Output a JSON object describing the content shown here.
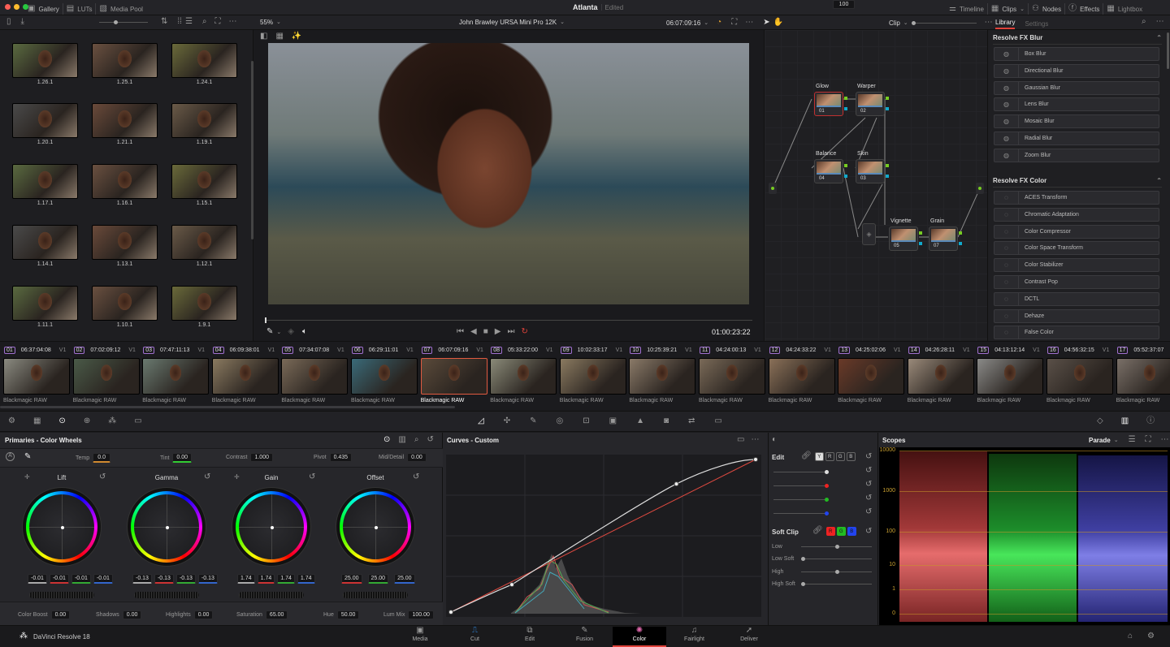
{
  "topbar": {
    "gallery": "Gallery",
    "luts": "LUTs",
    "media_pool": "Media Pool",
    "project": "Atlanta",
    "status": "Edited",
    "timeline": "Timeline",
    "clips": "Clips",
    "nodes": "Nodes",
    "effects": "Effects",
    "lightbox": "Lightbox"
  },
  "viewer": {
    "zoom": "55%",
    "clip_name": "John Brawley URSA Mini Pro 12K",
    "timecode": "06:07:09:16",
    "playhead": "01:00:23:22"
  },
  "nodes_bar": {
    "mode": "Clip"
  },
  "gallery": {
    "stills": [
      "1.26.1",
      "1.25.1",
      "1.24.1",
      "1.20.1",
      "1.21.1",
      "1.19.1",
      "1.17.1",
      "1.16.1",
      "1.15.1",
      "1.14.1",
      "1.13.1",
      "1.12.1",
      "1.11.1",
      "1.10.1",
      "1.9.1"
    ]
  },
  "node_graph": [
    {
      "name": "Glow",
      "num": "01"
    },
    {
      "name": "Warper",
      "num": "02"
    },
    {
      "name": "Balance",
      "num": "04"
    },
    {
      "name": "Skin",
      "num": "03"
    },
    {
      "name": "Vignette",
      "num": "05"
    },
    {
      "name": "Grain",
      "num": "07"
    }
  ],
  "library": {
    "tab_library": "Library",
    "tab_settings": "Settings",
    "blur_title": "Resolve FX Blur",
    "blur": [
      "Box Blur",
      "Directional Blur",
      "Gaussian Blur",
      "Lens Blur",
      "Mosaic Blur",
      "Radial Blur",
      "Zoom Blur"
    ],
    "color_title": "Resolve FX Color",
    "color": [
      "ACES Transform",
      "Chromatic Adaptation",
      "Color Compressor",
      "Color Space Transform",
      "Color Stabilizer",
      "Contrast Pop",
      "DCTL",
      "Dehaze",
      "False Color"
    ]
  },
  "clips": [
    {
      "num": "01",
      "tc": "06:37:04:08",
      "track": "V1",
      "codec": "Blackmagic RAW"
    },
    {
      "num": "02",
      "tc": "07:02:09:12",
      "track": "V1",
      "codec": "Blackmagic RAW"
    },
    {
      "num": "03",
      "tc": "07:47:11:13",
      "track": "V1",
      "codec": "Blackmagic RAW"
    },
    {
      "num": "04",
      "tc": "06:09:38:01",
      "track": "V1",
      "codec": "Blackmagic RAW"
    },
    {
      "num": "05",
      "tc": "07:34:07:08",
      "track": "V1",
      "codec": "Blackmagic RAW"
    },
    {
      "num": "06",
      "tc": "06:29:11:01",
      "track": "V1",
      "codec": "Blackmagic RAW"
    },
    {
      "num": "07",
      "tc": "06:07:09:16",
      "track": "V1",
      "codec": "Blackmagic RAW"
    },
    {
      "num": "08",
      "tc": "05:33:22:00",
      "track": "V1",
      "codec": "Blackmagic RAW"
    },
    {
      "num": "09",
      "tc": "10:02:33:17",
      "track": "V1",
      "codec": "Blackmagic RAW"
    },
    {
      "num": "10",
      "tc": "10:25:39:21",
      "track": "V1",
      "codec": "Blackmagic RAW"
    },
    {
      "num": "11",
      "tc": "04:24:00:13",
      "track": "V1",
      "codec": "Blackmagic RAW"
    },
    {
      "num": "12",
      "tc": "04:24:33:22",
      "track": "V1",
      "codec": "Blackmagic RAW"
    },
    {
      "num": "13",
      "tc": "04:25:02:06",
      "track": "V1",
      "codec": "Blackmagic RAW"
    },
    {
      "num": "14",
      "tc": "04:26:28:11",
      "track": "V1",
      "codec": "Blackmagic RAW"
    },
    {
      "num": "15",
      "tc": "04:13:12:14",
      "track": "V1",
      "codec": "Blackmagic RAW"
    },
    {
      "num": "16",
      "tc": "04:56:32:15",
      "track": "V1",
      "codec": "Blackmagic RAW"
    },
    {
      "num": "17",
      "tc": "05:52:37:07",
      "track": "",
      "codec": "Blackmagic RAW"
    }
  ],
  "selected_clip": "07",
  "primaries": {
    "title": "Primaries - Color Wheels",
    "temp_label": "Temp",
    "temp": "0.0",
    "tint_label": "Tint",
    "tint": "0.00",
    "contrast_label": "Contrast",
    "contrast": "1.000",
    "pivot_label": "Pivot",
    "pivot": "0.435",
    "md_label": "Mid/Detail",
    "md": "0.00",
    "wheels": [
      {
        "name": "Lift",
        "values": [
          "-0.01",
          "-0.01",
          "-0.01",
          "-0.01"
        ]
      },
      {
        "name": "Gamma",
        "values": [
          "-0.13",
          "-0.13",
          "-0.13",
          "-0.13"
        ]
      },
      {
        "name": "Gain",
        "values": [
          "1.74",
          "1.74",
          "1.74",
          "1.74"
        ]
      },
      {
        "name": "Offset",
        "values": [
          "25.00",
          "25.00",
          "25.00"
        ]
      }
    ],
    "cb_label": "Color Boost",
    "cb": "0.00",
    "sh_label": "Shadows",
    "sh": "0.00",
    "hl_label": "Highlights",
    "hl": "0.00",
    "sat_label": "Saturation",
    "sat": "65.00",
    "hue_label": "Hue",
    "hue": "50.00",
    "lm_label": "Lum Mix",
    "lm": "100.00"
  },
  "curves": {
    "title": "Curves - Custom",
    "points": [
      [
        0,
        0
      ],
      [
        0.2,
        0.18
      ],
      [
        0.74,
        0.84
      ],
      [
        1,
        1
      ]
    ]
  },
  "edit": {
    "label": "Edit",
    "channels": [
      "Y",
      "R",
      "G",
      "B"
    ],
    "values": [
      "100",
      "100",
      "100",
      "100"
    ],
    "softclip": "Soft Clip",
    "sc_channels": [
      "R",
      "G",
      "B"
    ],
    "low": "Low",
    "low_soft": "Low Soft",
    "high": "High",
    "high_soft": "High Soft"
  },
  "scopes": {
    "title": "Scopes",
    "mode": "Parade",
    "ticks": [
      "10000",
      "1000",
      "100",
      "10",
      "1",
      "0"
    ]
  },
  "app": {
    "name": "DaVinci Resolve 18"
  },
  "pages": [
    "Media",
    "Cut",
    "Edit",
    "Fusion",
    "Color",
    "Fairlight",
    "Deliver"
  ],
  "active_page": "Color",
  "colors": {
    "accent": "#e0423a",
    "selected": "#e05a40"
  }
}
